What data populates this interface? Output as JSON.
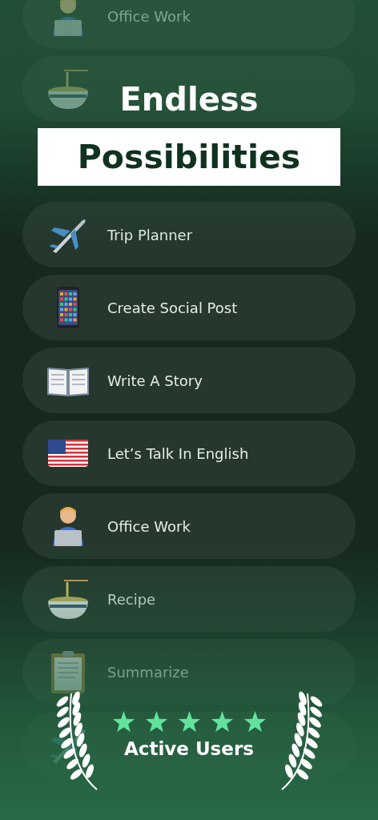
{
  "items": [
    {
      "kind": "worker",
      "label": "Office Work"
    },
    {
      "kind": "bowl"
    },
    {
      "kind": "blank"
    },
    {
      "kind": "plane",
      "label": "Trip Planner"
    },
    {
      "kind": "phone",
      "label": "Create Social Post"
    },
    {
      "kind": "book",
      "label": "Write A Story"
    },
    {
      "kind": "flag",
      "label": "Let’s Talk In English"
    },
    {
      "kind": "worker",
      "label": "Office Work"
    },
    {
      "kind": "bowl",
      "label": "Recipe"
    },
    {
      "kind": "clipboard",
      "label": "Summarize"
    },
    {
      "kind": "plane"
    }
  ],
  "headline": {
    "line_1": "Endless",
    "line_2": "Possibilities"
  },
  "rating": {
    "stars": 5,
    "caption": "Active Users"
  }
}
